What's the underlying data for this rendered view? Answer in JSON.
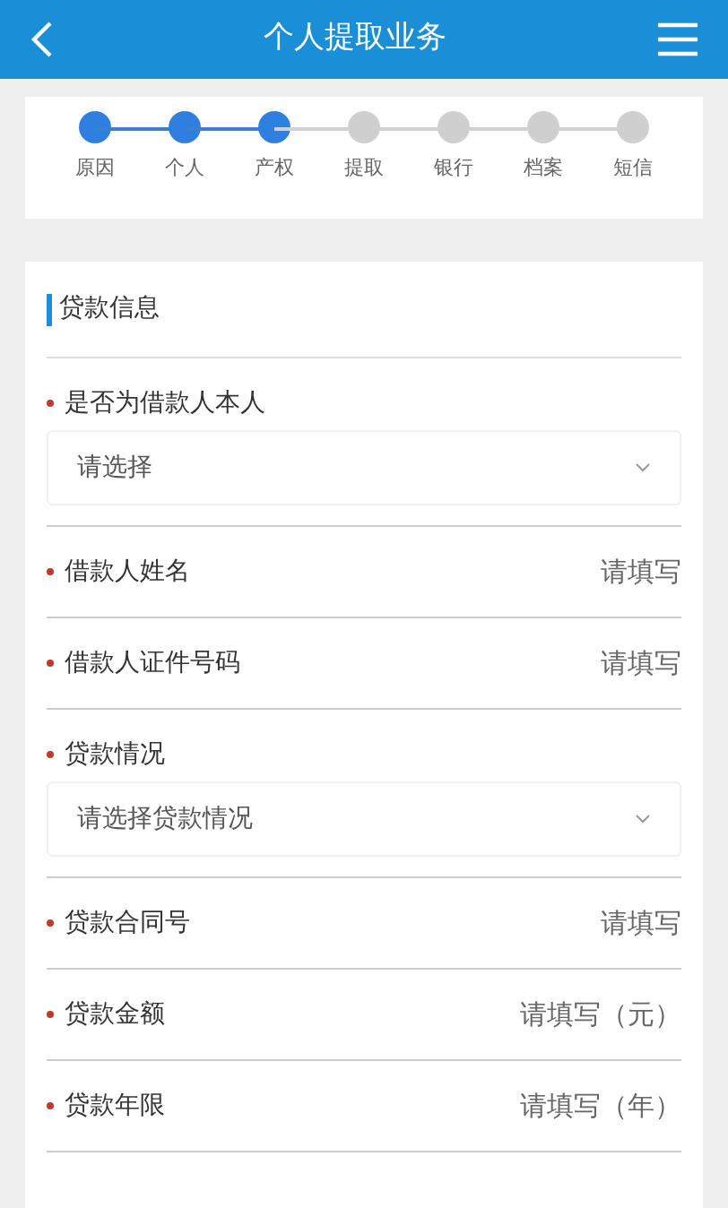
{
  "header": {
    "title": "个人提取业务"
  },
  "steps": [
    {
      "label": "原因",
      "done": true
    },
    {
      "label": "个人",
      "done": true
    },
    {
      "label": "产权",
      "done": true
    },
    {
      "label": "提取",
      "done": false
    },
    {
      "label": "银行",
      "done": false
    },
    {
      "label": "档案",
      "done": false
    },
    {
      "label": "短信",
      "done": false
    }
  ],
  "section": {
    "title": "贷款信息"
  },
  "fields": [
    {
      "kind": "select",
      "label": "是否为借款人本人",
      "required": true,
      "placeholder": "请选择"
    },
    {
      "kind": "text",
      "label": "借款人姓名",
      "required": true,
      "placeholder": "请填写"
    },
    {
      "kind": "text",
      "label": "借款人证件号码",
      "required": true,
      "placeholder": "请填写"
    },
    {
      "kind": "select",
      "label": "贷款情况",
      "required": true,
      "placeholder": "请选择贷款情况"
    },
    {
      "kind": "text",
      "label": "贷款合同号",
      "required": true,
      "placeholder": "请填写"
    },
    {
      "kind": "text",
      "label": "贷款金额",
      "required": true,
      "placeholder": "请填写（元）"
    },
    {
      "kind": "text",
      "label": "贷款年限",
      "required": true,
      "placeholder": "请填写（年）"
    }
  ]
}
